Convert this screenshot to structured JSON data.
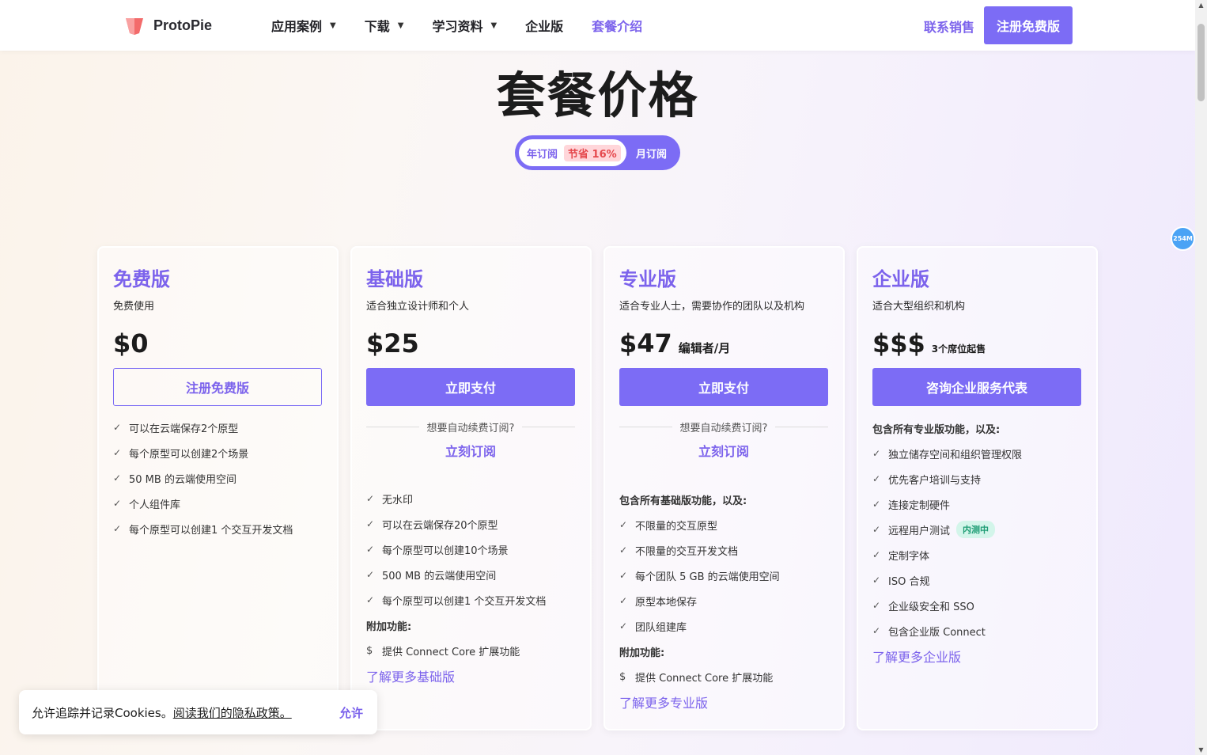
{
  "nav": {
    "brand": "ProtoPie",
    "items": [
      {
        "label": "应用案例",
        "caret": "▼"
      },
      {
        "label": "下载",
        "caret": "▼"
      },
      {
        "label": "学习资料",
        "caret": "▼"
      },
      {
        "label": "企业版",
        "caret": ""
      },
      {
        "label": "套餐介绍",
        "caret": ""
      }
    ],
    "contact_label": "联系销售",
    "signup_label": "注册免费版"
  },
  "page": {
    "title": "套餐价格"
  },
  "billing": {
    "yearly_label": "年订阅",
    "save_label": "节省 16%",
    "monthly_label": "月订阅"
  },
  "memory_badge": "254M",
  "plans": [
    {
      "name": "免费版",
      "desc": "免费使用",
      "price": "$0",
      "price_note": "",
      "cta": "注册免费版",
      "features": [
        "可以在云端保存2个原型",
        "每个原型可以创建2个场景",
        "50 MB 的云端使用空间",
        "个人组件库",
        "每个原型可以创建1 个交互开发文档"
      ]
    },
    {
      "name": "基础版",
      "desc": "适合独立设计师和个人",
      "price": "$25",
      "price_note": "",
      "cta": "立即支付",
      "renew_text": "想要自动续费订阅?",
      "renew_link": "立刻订阅",
      "features": [
        "无水印",
        "可以在云端保存20个原型",
        "每个原型可以创建10个场景",
        "500 MB 的云端使用空间",
        "每个原型可以创建1 个交互开发文档"
      ],
      "addon_heading": "附加功能:",
      "addon": "提供 Connect Core 扩展功能",
      "learn_more": "了解更多基础版"
    },
    {
      "name": "专业版",
      "desc": "适合专业人士，需要协作的团队以及机构",
      "price": "$47",
      "price_note": "编辑者/月",
      "cta": "立即支付",
      "renew_text": "想要自动续费订阅?",
      "renew_link": "立刻订阅",
      "features_heading": "包含所有基础版功能，以及:",
      "features": [
        "不限量的交互原型",
        "不限量的交互开发文档",
        "每个团队 5 GB 的云端使用空间",
        "原型本地保存",
        "团队组建库"
      ],
      "addon_heading": "附加功能:",
      "addon": "提供 Connect Core 扩展功能",
      "learn_more": "了解更多专业版"
    },
    {
      "name": "企业版",
      "desc": "适合大型组织和机构",
      "price": "$$$",
      "price_note": "3个席位起售",
      "cta": "咨询企业服务代表",
      "features_heading": "包含所有专业版功能，以及:",
      "features": [
        "独立储存空间和组织管理权限",
        "优先客户培训与支持",
        "连接定制硬件",
        "远程用户测试",
        "定制字体",
        "ISO 合规",
        "企业级安全和 SSO",
        "包含企业版 Connect"
      ],
      "beta_label": "内测中",
      "learn_more": "了解更多企业版"
    }
  ],
  "cookie": {
    "text": "允许追踪并记录Cookies。",
    "link": "阅读我们的隐私政策。",
    "accept": "允许"
  },
  "colors": {
    "accent": "#7c6cf5",
    "accent_text": "#7c63ec",
    "save_badge_bg": "#ffd6da",
    "save_badge_text": "#e5484d",
    "beta_bg": "#d3f5ea",
    "beta_text": "#1f9d75"
  }
}
